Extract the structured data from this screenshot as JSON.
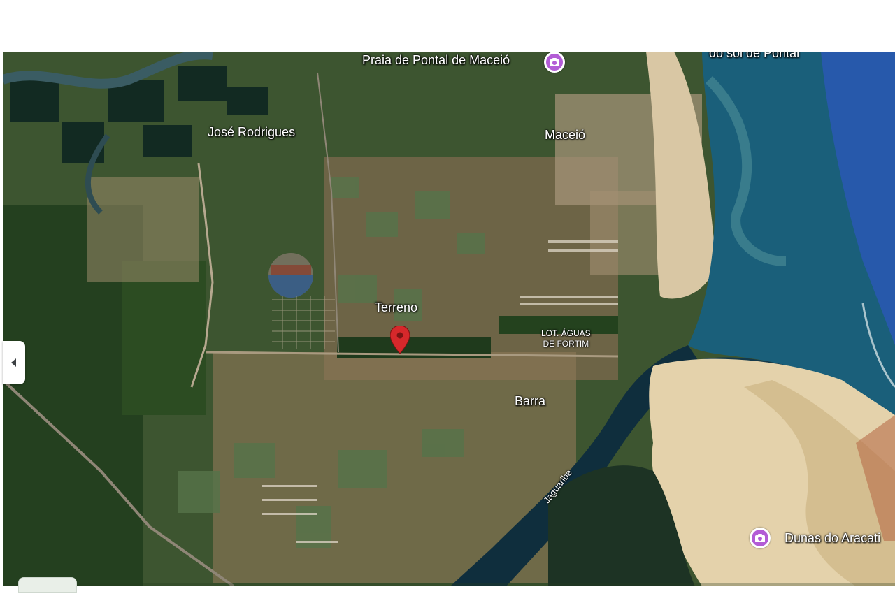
{
  "map": {
    "type": "satellite",
    "labels": {
      "praia": "Praia de Pontal de Maceió",
      "do_sol": "do sol de Pontal",
      "jose": "José Rodrigues",
      "maceio": "Maceió",
      "terreno": "Terreno",
      "lot_line1": "LOT. ÁGUAS",
      "lot_line2": "DE FORTIM",
      "barra": "Barra",
      "river": "Jaguaribe",
      "dunas": "Dunas do Aracati"
    },
    "icons": {
      "poi": "camera-icon",
      "marker": "red-pin-icon",
      "collapse": "chevron-left-icon"
    },
    "colors": {
      "poi": "#b35cd6",
      "marker": "#d6282b",
      "ocean": "#1a5f7a",
      "river": "#0f2e3d"
    }
  }
}
